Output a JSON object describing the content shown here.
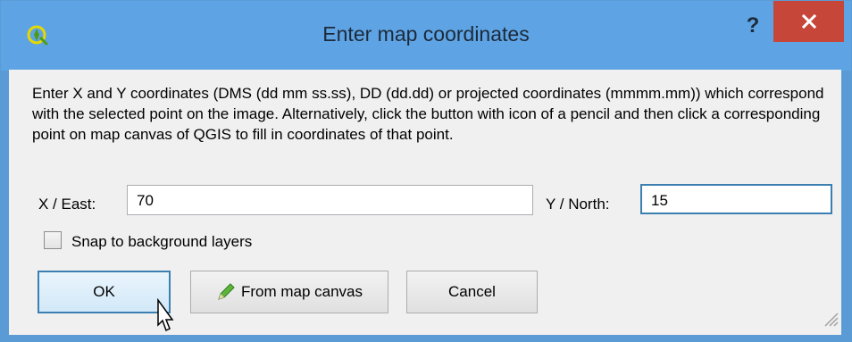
{
  "window": {
    "title": "Enter map coordinates",
    "help_label": "?",
    "app_icon": "qgis-icon",
    "close_icon": "close-icon"
  },
  "description": "Enter X and Y coordinates (DMS (dd mm ss.ss), DD (dd.dd) or projected coordinates (mmmm.mm)) which correspond with the selected point on the image. Alternatively, click the button with icon of a pencil and then click a corresponding point on map canvas of QGIS to fill in coordinates of that point.",
  "fields": {
    "x_label": "X / East:",
    "x_value": "70",
    "y_label": "Y / North:",
    "y_value": "15"
  },
  "snap": {
    "label": "Snap to background layers",
    "checked": false
  },
  "buttons": {
    "ok": "OK",
    "from_map_canvas": "From map canvas",
    "pencil_icon": "pencil-icon",
    "cancel": "Cancel"
  },
  "colors": {
    "titlebar": "#5ea4e4",
    "close_button": "#c7463a",
    "focus_border": "#3c7fb1"
  }
}
